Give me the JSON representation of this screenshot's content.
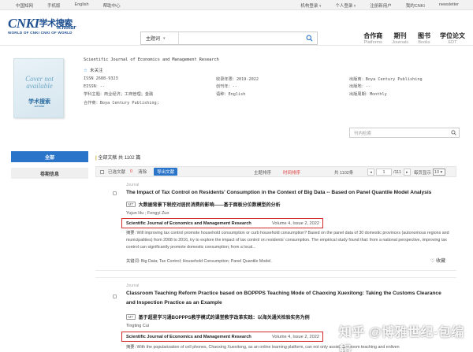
{
  "topbar": {
    "left": [
      "中国知网",
      "手机版",
      "English",
      "帮助中心"
    ],
    "right": [
      "机构登录",
      "个人登录",
      "注册新用户",
      "我的CNKI",
      "newsletter"
    ]
  },
  "logo": {
    "text": "CNKI",
    "cn": "学术搜索",
    "en": "scholar",
    "tagline": "WORLD OF CNKI CNKI OF WORLD"
  },
  "search": {
    "field_select": "主题词",
    "placeholder": ""
  },
  "nav": [
    {
      "zh": "合作商",
      "en": "Platforms"
    },
    {
      "zh": "期刊",
      "en": "Journals"
    },
    {
      "zh": "图书",
      "en": "Books"
    },
    {
      "zh": "学位论文",
      "en": "EDT"
    }
  ],
  "journal": {
    "cover_text": "Cover not available",
    "cover_logo": "学术搜索",
    "cover_logo_en": "scholar",
    "title": "Scientific Journal of Economics and Management Research",
    "follow": "未关注",
    "issn": "ISSN 2688-9323",
    "eissn": "EISSN：--",
    "subject": "学科主题：商业经济；工商管理；金融",
    "publisher": "合作商：Boya Century Publishing;",
    "coverage": "收录年限：2019-2022",
    "founded": "创刊年：--",
    "language": "语种：English",
    "pub_org": "出版商：Boya Century Publishing",
    "country": "出版地：--",
    "frequency": "出版周期：Monthly"
  },
  "left_buttons": {
    "all": "全部",
    "by_volume": "卷期信息"
  },
  "in_search": {
    "placeholder": "刊内检索"
  },
  "listing": {
    "header": "全部文献",
    "count": "共 1102 篇",
    "selected": "已选文献",
    "selected_count": "0",
    "clear": "清除",
    "export": "导出文献",
    "sort_subject": "主题排序",
    "sort_time": "时间排序",
    "total": "共 1102条",
    "page": "1",
    "pages": "/111",
    "page_size_label": "每页显示",
    "page_size": "10"
  },
  "articles": [
    {
      "label": "Journal",
      "title": "The Impact of Tax Control on Residents' Consumption in the Context of Big Data -- Based on Panel Quantile Model Analysis",
      "mt_tag": "MT",
      "mt_title": "大数据背景下税控对居民消费的影响——基于面板分位数模型的分析",
      "authors": "Yujun Hu ; Fengyi Zuo",
      "source": "Scientific Journal of Economics and Management Research",
      "volume": "Volume 4, Issue 2, 2022",
      "abstract": "摘要: Will improving tax control promote household consumption or curb household consumption? Based on the panel data of 30 domestic provinces (autonomous regions and municipalities) from 2008 to 2016, try to explore the impact of tax control on residents' consumption. The empirical study found that: from a national perspective, improving tax control can significantly promote domestic consumption; from a local...",
      "keywords": "关键词: Big Data; Tax Control; Household Consumption; Panel Quantile Model.",
      "fav": "收藏"
    },
    {
      "label": "Journal",
      "title": "Classroom Teaching Reform Practice based on BOPPPS Teaching Mode of Chaoxing Xuexitong: Taking the Customs Clearance and Inspection Practice as an Example",
      "mt_tag": "MT",
      "mt_title": "基于超星学习通BOPPPS教学模式的课堂教学改革实践：以海关通关检验实务为例",
      "authors": "Tingting Cui",
      "source": "Scientific Journal of Economics and Management Research",
      "volume": "Volume 4, Issue 2, 2022",
      "abstract": "摘要: With the popularization of cell phones, Chaoxing Xuexitong, as an online learning platform, can not only assist classroom teaching and enliven"
    }
  ],
  "watermark": "知乎 @博雅世纪-包编辑",
  "colors": {
    "accent": "#2a74c9",
    "highlight": "#d42a2a",
    "logo": "#1d4f91"
  }
}
